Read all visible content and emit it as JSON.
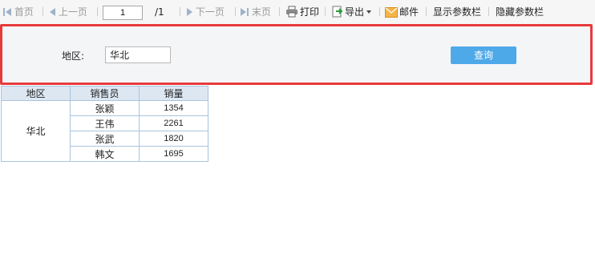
{
  "toolbar": {
    "first": "首页",
    "prev": "上一页",
    "page_value": "1",
    "page_total": "/1",
    "next": "下一页",
    "last": "末页",
    "print": "打印",
    "export": "导出",
    "mail": "邮件",
    "show_params": "显示参数栏",
    "hide_params": "隐藏参数栏"
  },
  "params": {
    "region_label": "地区:",
    "region_value": "华北",
    "query_button": "查询"
  },
  "table": {
    "headers": [
      "地区",
      "销售员",
      "销量"
    ],
    "region": "华北",
    "rows": [
      {
        "salesperson": "张颖",
        "sales": "1354"
      },
      {
        "salesperson": "王伟",
        "sales": "2261"
      },
      {
        "salesperson": "张武",
        "sales": "1820"
      },
      {
        "salesperson": "韩文",
        "sales": "1695"
      }
    ]
  },
  "colors": {
    "highlight_border": "#e83a3a",
    "query_button": "#4ea9e8",
    "header_bg": "#dde7f2",
    "grid_line": "#a8c4df"
  }
}
